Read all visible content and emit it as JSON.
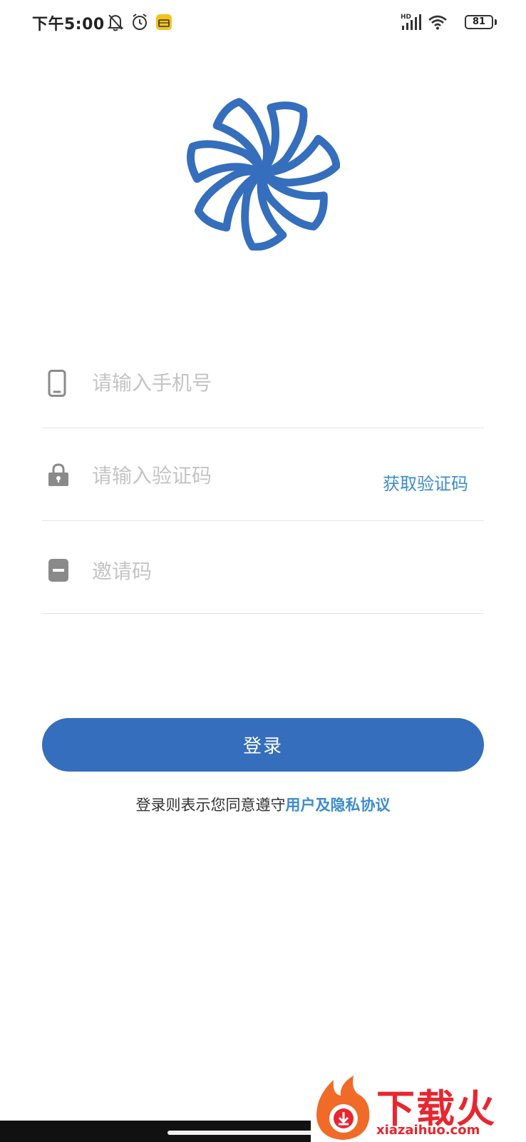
{
  "status_bar": {
    "time": "下午5:00",
    "network": "HD",
    "battery": "81",
    "icons": [
      "bell-off-icon",
      "alarm-icon",
      "app-notification-icon",
      "signal-icon",
      "wifi-icon",
      "battery-icon"
    ]
  },
  "logo": {
    "icon": "pinwheel-logo-icon",
    "color": "#356ebc"
  },
  "form": {
    "phone_placeholder": "请输入手机号",
    "code_placeholder": "请输入验证码",
    "get_code_label": "获取验证码",
    "invite_placeholder": "邀请码"
  },
  "login": {
    "button_label": "登录",
    "agreement_prefix": "登录则表示您同意遵守",
    "agreement_link": "用户及隐私协议"
  },
  "watermark": {
    "text": "下载火",
    "url": "xiazaihuo.com"
  },
  "colors": {
    "primary": "#356ebc",
    "link": "#3d8ccd",
    "watermark": "#e8262f"
  }
}
